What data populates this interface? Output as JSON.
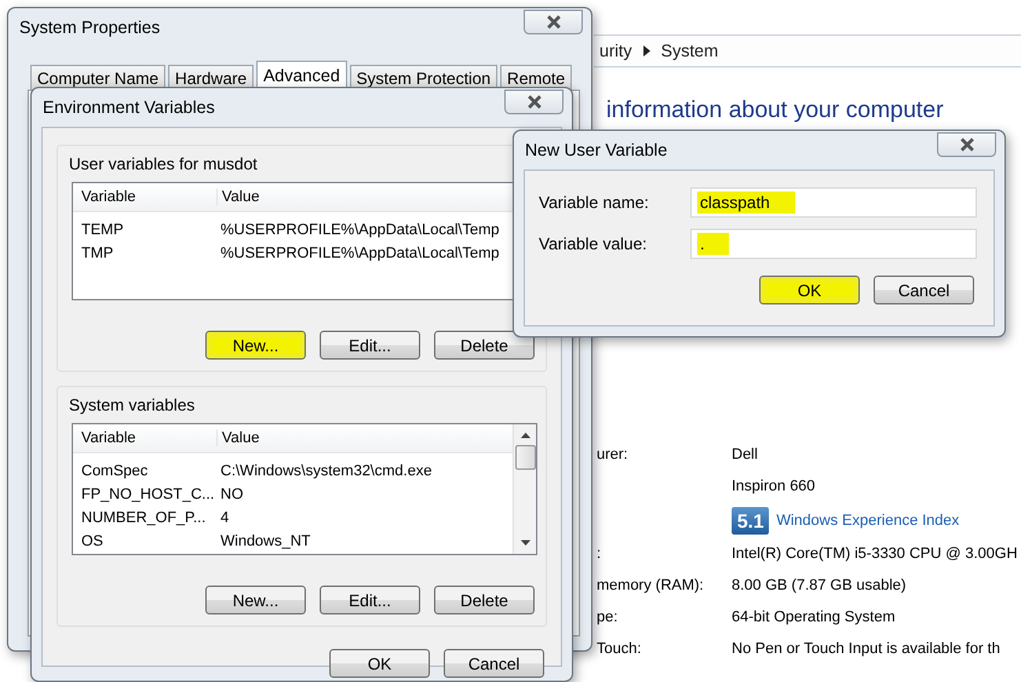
{
  "background_window": {
    "breadcrumb": [
      "urity",
      "System"
    ],
    "heading": "information about your computer",
    "info_rows": [
      {
        "kind": "text",
        "label": "urer:",
        "value": "Dell"
      },
      {
        "kind": "text",
        "value": "Inspiron 660"
      },
      {
        "kind": "rating",
        "badge": "5.1",
        "value": "Windows Experience Index"
      },
      {
        "kind": "text",
        "label": ":",
        "value": "Intel(R) Core(TM) i5-3330 CPU @ 3.00GH"
      },
      {
        "kind": "text",
        "label": "memory (RAM):",
        "value": "8.00 GB (7.87 GB usable)"
      },
      {
        "kind": "text",
        "label": "pe:",
        "value": "64-bit Operating System"
      },
      {
        "kind": "text",
        "label": "Touch:",
        "value": "No Pen or Touch Input is available for th"
      }
    ]
  },
  "system_properties": {
    "title": "System Properties",
    "tabs": [
      {
        "label": "Computer Name",
        "selected": false
      },
      {
        "label": "Hardware",
        "selected": false
      },
      {
        "label": "Advanced",
        "selected": true
      },
      {
        "label": "System Protection",
        "selected": false
      },
      {
        "label": "Remote",
        "selected": false
      }
    ]
  },
  "environment_variables": {
    "title": "Environment Variables",
    "user_variables": {
      "label": "User variables for musdot",
      "columns": [
        "Variable",
        "Value"
      ],
      "rows": [
        {
          "variable": "TEMP",
          "value": "%USERPROFILE%\\AppData\\Local\\Temp"
        },
        {
          "variable": "TMP",
          "value": "%USERPROFILE%\\AppData\\Local\\Temp"
        }
      ],
      "buttons": [
        {
          "label": "New...",
          "highlighted": true
        },
        {
          "label": "Edit...",
          "highlighted": false
        },
        {
          "label": "Delete",
          "highlighted": false
        }
      ]
    },
    "system_variables": {
      "label": "System variables",
      "columns": [
        "Variable",
        "Value"
      ],
      "rows": [
        {
          "variable": "ComSpec",
          "value": "C:\\Windows\\system32\\cmd.exe"
        },
        {
          "variable": "FP_NO_HOST_C...",
          "value": "NO"
        },
        {
          "variable": "NUMBER_OF_P...",
          "value": "4"
        },
        {
          "variable": "OS",
          "value": "Windows_NT"
        }
      ],
      "buttons": [
        {
          "label": "New...",
          "highlighted": false
        },
        {
          "label": "Edit...",
          "highlighted": false
        },
        {
          "label": "Delete",
          "highlighted": false
        }
      ]
    },
    "buttons": [
      {
        "label": "OK",
        "highlighted": false
      },
      {
        "label": "Cancel",
        "highlighted": false
      }
    ]
  },
  "new_user_variable": {
    "title": "New User Variable",
    "fields": [
      {
        "label": "Variable name:",
        "value": "classpath",
        "highlighted": true
      },
      {
        "label": "Variable value:",
        "value": ".",
        "highlighted": true
      }
    ],
    "buttons": [
      {
        "label": "OK",
        "highlighted": true
      },
      {
        "label": "Cancel",
        "highlighted": false
      }
    ]
  }
}
